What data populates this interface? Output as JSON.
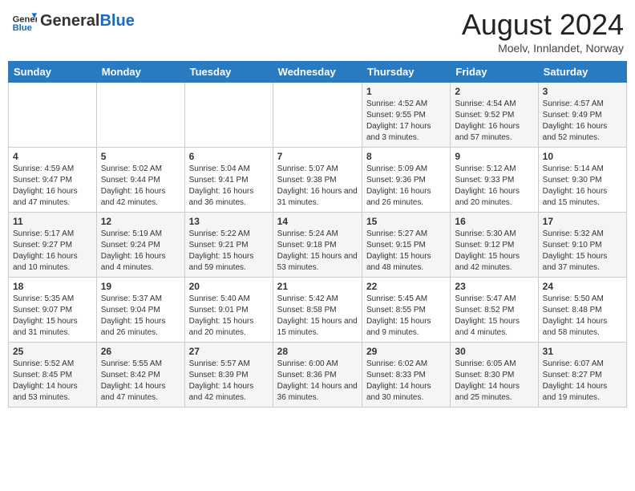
{
  "header": {
    "logo_general": "General",
    "logo_blue": "Blue",
    "month_title": "August 2024",
    "location": "Moelv, Innlandet, Norway"
  },
  "weekdays": [
    "Sunday",
    "Monday",
    "Tuesday",
    "Wednesday",
    "Thursday",
    "Friday",
    "Saturday"
  ],
  "weeks": [
    [
      null,
      null,
      null,
      null,
      {
        "day": "1",
        "sunrise": "4:52 AM",
        "sunset": "9:55 PM",
        "daylight": "17 hours and 3 minutes."
      },
      {
        "day": "2",
        "sunrise": "4:54 AM",
        "sunset": "9:52 PM",
        "daylight": "16 hours and 57 minutes."
      },
      {
        "day": "3",
        "sunrise": "4:57 AM",
        "sunset": "9:49 PM",
        "daylight": "16 hours and 52 minutes."
      }
    ],
    [
      {
        "day": "4",
        "sunrise": "4:59 AM",
        "sunset": "9:47 PM",
        "daylight": "16 hours and 47 minutes."
      },
      {
        "day": "5",
        "sunrise": "5:02 AM",
        "sunset": "9:44 PM",
        "daylight": "16 hours and 42 minutes."
      },
      {
        "day": "6",
        "sunrise": "5:04 AM",
        "sunset": "9:41 PM",
        "daylight": "16 hours and 36 minutes."
      },
      {
        "day": "7",
        "sunrise": "5:07 AM",
        "sunset": "9:38 PM",
        "daylight": "16 hours and 31 minutes."
      },
      {
        "day": "8",
        "sunrise": "5:09 AM",
        "sunset": "9:36 PM",
        "daylight": "16 hours and 26 minutes."
      },
      {
        "day": "9",
        "sunrise": "5:12 AM",
        "sunset": "9:33 PM",
        "daylight": "16 hours and 20 minutes."
      },
      {
        "day": "10",
        "sunrise": "5:14 AM",
        "sunset": "9:30 PM",
        "daylight": "16 hours and 15 minutes."
      }
    ],
    [
      {
        "day": "11",
        "sunrise": "5:17 AM",
        "sunset": "9:27 PM",
        "daylight": "16 hours and 10 minutes."
      },
      {
        "day": "12",
        "sunrise": "5:19 AM",
        "sunset": "9:24 PM",
        "daylight": "16 hours and 4 minutes."
      },
      {
        "day": "13",
        "sunrise": "5:22 AM",
        "sunset": "9:21 PM",
        "daylight": "15 hours and 59 minutes."
      },
      {
        "day": "14",
        "sunrise": "5:24 AM",
        "sunset": "9:18 PM",
        "daylight": "15 hours and 53 minutes."
      },
      {
        "day": "15",
        "sunrise": "5:27 AM",
        "sunset": "9:15 PM",
        "daylight": "15 hours and 48 minutes."
      },
      {
        "day": "16",
        "sunrise": "5:30 AM",
        "sunset": "9:12 PM",
        "daylight": "15 hours and 42 minutes."
      },
      {
        "day": "17",
        "sunrise": "5:32 AM",
        "sunset": "9:10 PM",
        "daylight": "15 hours and 37 minutes."
      }
    ],
    [
      {
        "day": "18",
        "sunrise": "5:35 AM",
        "sunset": "9:07 PM",
        "daylight": "15 hours and 31 minutes."
      },
      {
        "day": "19",
        "sunrise": "5:37 AM",
        "sunset": "9:04 PM",
        "daylight": "15 hours and 26 minutes."
      },
      {
        "day": "20",
        "sunrise": "5:40 AM",
        "sunset": "9:01 PM",
        "daylight": "15 hours and 20 minutes."
      },
      {
        "day": "21",
        "sunrise": "5:42 AM",
        "sunset": "8:58 PM",
        "daylight": "15 hours and 15 minutes."
      },
      {
        "day": "22",
        "sunrise": "5:45 AM",
        "sunset": "8:55 PM",
        "daylight": "15 hours and 9 minutes."
      },
      {
        "day": "23",
        "sunrise": "5:47 AM",
        "sunset": "8:52 PM",
        "daylight": "15 hours and 4 minutes."
      },
      {
        "day": "24",
        "sunrise": "5:50 AM",
        "sunset": "8:48 PM",
        "daylight": "14 hours and 58 minutes."
      }
    ],
    [
      {
        "day": "25",
        "sunrise": "5:52 AM",
        "sunset": "8:45 PM",
        "daylight": "14 hours and 53 minutes."
      },
      {
        "day": "26",
        "sunrise": "5:55 AM",
        "sunset": "8:42 PM",
        "daylight": "14 hours and 47 minutes."
      },
      {
        "day": "27",
        "sunrise": "5:57 AM",
        "sunset": "8:39 PM",
        "daylight": "14 hours and 42 minutes."
      },
      {
        "day": "28",
        "sunrise": "6:00 AM",
        "sunset": "8:36 PM",
        "daylight": "14 hours and 36 minutes."
      },
      {
        "day": "29",
        "sunrise": "6:02 AM",
        "sunset": "8:33 PM",
        "daylight": "14 hours and 30 minutes."
      },
      {
        "day": "30",
        "sunrise": "6:05 AM",
        "sunset": "8:30 PM",
        "daylight": "14 hours and 25 minutes."
      },
      {
        "day": "31",
        "sunrise": "6:07 AM",
        "sunset": "8:27 PM",
        "daylight": "14 hours and 19 minutes."
      }
    ]
  ]
}
